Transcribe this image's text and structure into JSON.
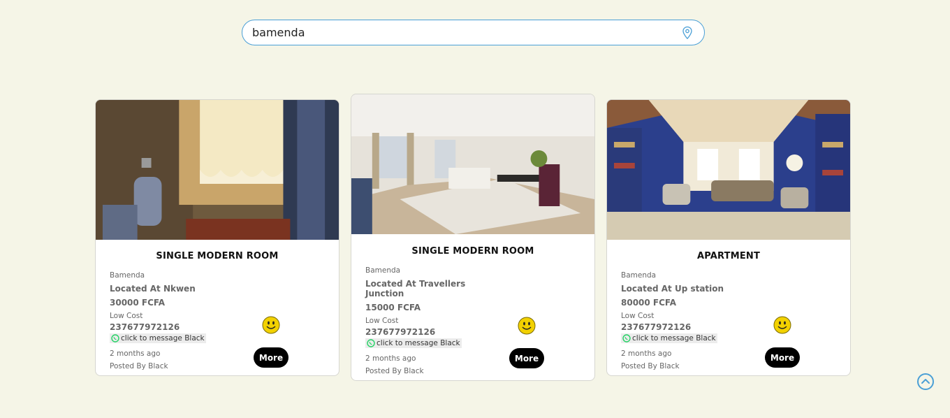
{
  "search": {
    "value": "bamenda",
    "icon": "location-pin-icon"
  },
  "colors": {
    "background": "#f5f5e7",
    "accent": "#4a9fd6",
    "button": "#000000"
  },
  "listings": [
    {
      "title": "SINGLE MODERN ROOM",
      "city": "Bamenda",
      "location": "Located At Nkwen",
      "price": "30000 FCFA",
      "cost_label": "Low Cost",
      "phone": "237677972126",
      "message": "click to message Black",
      "time": "2 months ago",
      "posted_by": "Posted By Black",
      "more_label": "More"
    },
    {
      "title": "SINGLE MODERN ROOM",
      "city": "Bamenda",
      "location": "Located At Travellers Junction",
      "price": "15000 FCFA",
      "cost_label": "Low Cost",
      "phone": "237677972126",
      "message": "click to message Black",
      "time": "2 months ago",
      "posted_by": "Posted By Black",
      "more_label": "More"
    },
    {
      "title": "APARTMENT",
      "city": "Bamenda",
      "location": "Located At Up station",
      "price": "80000 FCFA",
      "cost_label": "Low Cost",
      "phone": "237677972126",
      "message": "click to message Black",
      "time": "2 months ago",
      "posted_by": "Posted By Black",
      "more_label": "More"
    }
  ]
}
